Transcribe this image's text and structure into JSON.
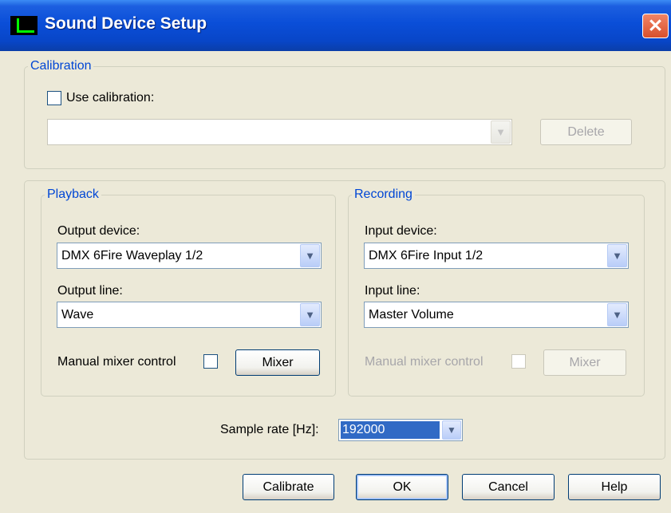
{
  "window": {
    "title": "Sound Device Setup",
    "close_glyph": "✕"
  },
  "calibration": {
    "legend": "Calibration",
    "use_label": "Use calibration:",
    "use_checked": false,
    "file_value": "",
    "delete_label": "Delete"
  },
  "playback": {
    "legend": "Playback",
    "device_label": "Output device:",
    "device_value": "DMX 6Fire Waveplay 1/2",
    "line_label": "Output line:",
    "line_value": "Wave",
    "manual_label": "Manual mixer control",
    "manual_checked": false,
    "mixer_label": "Mixer"
  },
  "recording": {
    "legend": "Recording",
    "device_label": "Input device:",
    "device_value": "DMX 6Fire Input 1/2",
    "line_label": "Input line:",
    "line_value": "Master Volume",
    "manual_label": "Manual mixer control",
    "manual_checked": false,
    "mixer_label": "Mixer"
  },
  "sample_rate": {
    "label": "Sample rate [Hz]:",
    "value": "192000"
  },
  "buttons": {
    "calibrate": "Calibrate",
    "ok": "OK",
    "cancel": "Cancel",
    "help": "Help"
  },
  "icons": {
    "dropdown_arrow": "▼"
  },
  "colors": {
    "title_bar": "#0a4ed8",
    "group_legend": "#0046d5",
    "selection": "#316ac5",
    "close_button": "#d8502c"
  }
}
